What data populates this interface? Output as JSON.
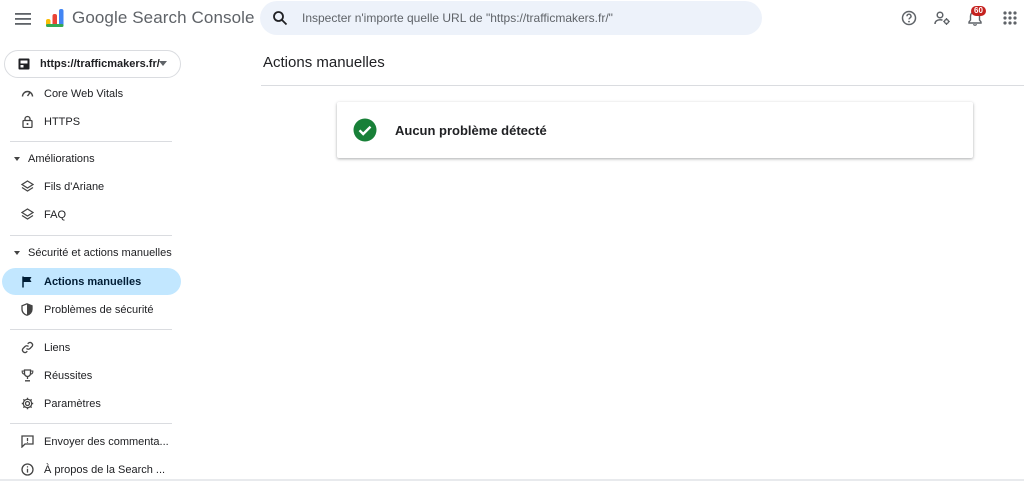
{
  "header": {
    "app_name": "Google Search Console",
    "search_placeholder": "Inspecter n'importe quelle URL de \"https://trafficmakers.fr/\"",
    "notification_count": "60",
    "icons": [
      "menu-icon",
      "search-icon",
      "help-icon",
      "manage-users-icon",
      "bell-icon",
      "apps-icon"
    ]
  },
  "sidebar": {
    "property": "https://trafficmakers.fr/",
    "items": {
      "core_web_vitals": "Core Web Vitals",
      "https": "HTTPS",
      "ameliorations": "Améliorations",
      "fils_ariane": "Fils d'Ariane",
      "faq": "FAQ",
      "securite_section": "Sécurité et actions manuelles",
      "actions_manuelles": "Actions manuelles",
      "problemes_securite": "Problèmes de sécurité",
      "liens": "Liens",
      "reussites": "Réussites",
      "parametres": "Paramètres",
      "envoyer_commentaires": "Envoyer des commenta...",
      "a_propos": "À propos de la Search ..."
    }
  },
  "main": {
    "title": "Actions manuelles",
    "status_text": "Aucun problème détecté"
  },
  "colors": {
    "accent_active": "#c2e7ff",
    "success_green": "#188038",
    "search_bg": "#edf2fa",
    "badge_red": "#c5221f"
  }
}
